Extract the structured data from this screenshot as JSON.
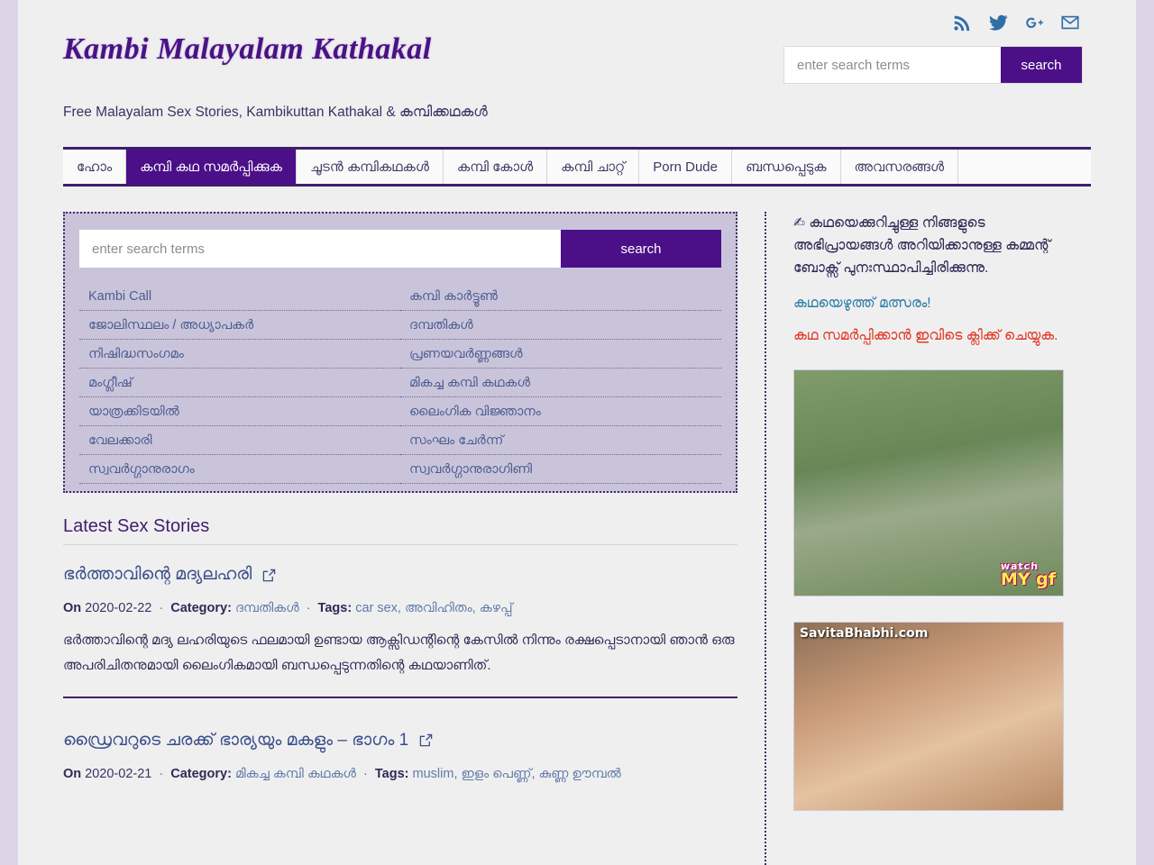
{
  "site": {
    "title": "Kambi Malayalam Kathakal",
    "tagline": "Free Malayalam Sex Stories, Kambikuttan Kathakal & കമ്പിക്കഥകൾ",
    "accent_purple": "#4b1087",
    "accent_dark": "#3d1e6d",
    "page_bg": "#dcd3e7",
    "content_bg": "#f0eff0"
  },
  "social": [
    {
      "name": "rss-icon",
      "label": "RSS"
    },
    {
      "name": "twitter-icon",
      "label": "Twitter"
    },
    {
      "name": "googleplus-icon",
      "label": "Google Plus"
    },
    {
      "name": "email-icon",
      "label": "Email"
    }
  ],
  "header_search": {
    "placeholder": "enter search terms",
    "value": "",
    "button_label": "search"
  },
  "nav": {
    "items": [
      {
        "label": "ഹോം",
        "active": false
      },
      {
        "label": "കമ്പി കഥ സമർപ്പിക്കുക",
        "active": true
      },
      {
        "label": "ചൂടൻ കമ്പികഥകൾ",
        "active": false
      },
      {
        "label": "കമ്പി കോൾ",
        "active": false
      },
      {
        "label": "കമ്പി ചാറ്റ്",
        "active": false
      },
      {
        "label": "Porn Dude",
        "active": false
      },
      {
        "label": "ബന്ധപ്പെടുക",
        "active": false
      },
      {
        "label": "അവസരങ്ങൾ",
        "active": false
      }
    ]
  },
  "panel_search": {
    "placeholder": "enter search terms",
    "value": "",
    "button_label": "search"
  },
  "categories": {
    "left": [
      "Kambi Call",
      "ജോലിസ്ഥലം / അധ്യാപകർ",
      "നിഷിദ്ധസംഗമം",
      "മംഗ്ലീഷ്",
      "യാത്രക്കിടയിൽ",
      "വേലക്കാരി",
      "സ്വവർഗ്ഗാനുരാഗം"
    ],
    "right": [
      "കമ്പി കാർട്ടൂൺ",
      "ദമ്പതികൾ",
      "പ്രണയവർണ്ണങ്ങൾ",
      "മികച്ച കമ്പി കഥകൾ",
      "ലൈംഗിക വിജ്ഞാനം",
      "സംഘം ചേർന്ന്",
      "സ്വവർഗ്ഗാനുരാഗിണി"
    ]
  },
  "latest": {
    "heading": "Latest Sex Stories",
    "posts": [
      {
        "title": "ഭർത്താവിന്റെ മദ്യലഹരി",
        "on_label": "On",
        "date": "2020-02-22",
        "category_label": "Category:",
        "category": "ദമ്പതികൾ",
        "tags_label": "Tags:",
        "tags": "car sex, അവിഹിതം, കഴപ്പ്",
        "excerpt": "ഭർത്താവിന്റെ മദ്യ ലഹരിയുടെ ഫലമായി ഉണ്ടായ ആക്സിഡന്റിന്റെ കേസിൽ നിന്നും രക്ഷപ്പെടാനായി ഞാൻ ഒരു അപരിചിതനുമായി ലൈംഗികമായി ബന്ധപ്പെടുന്നതിന്റെ കഥയാണിത്."
      },
      {
        "title": "ഡ്രൈവറുടെ ചരക്ക് ഭാര്യയും മകളും – ഭാഗം 1",
        "on_label": "On",
        "date": "2020-02-21",
        "category_label": "Category:",
        "category": "മികച്ച കമ്പി കഥകൾ",
        "tags_label": "Tags:",
        "tags": "muslim, ഇളം പെണ്ണ്, കുണ്ണ ഊമ്പൽ",
        "excerpt": ""
      }
    ]
  },
  "sidebar": {
    "pencil_icon": "✍",
    "note": "കഥയെക്കുറിച്ചുള്ള നിങ്ങളുടെ അഭിപ്രായങ്ങൾ അറിയിക്കാനുള്ള കമ്മന്റ് ബോക്സ് പുനഃസ്ഥാപിച്ചിരിക്കുന്നു.",
    "link_blue": "കഥയെഴുത്ത് മത്സരം!",
    "link_red": "കഥ സമർപ്പിക്കാൻ ഇവിടെ ക്ലിക്ക് ചെയ്യുക.",
    "ads": [
      {
        "name": "ad-watchmygf",
        "badge_top": "watch",
        "badge_bottom": "MY gf",
        "watermark": ""
      },
      {
        "name": "ad-savitabhabhi",
        "badge_top": "",
        "badge_bottom": "",
        "watermark": "SavitaBhabhi.com"
      }
    ]
  }
}
